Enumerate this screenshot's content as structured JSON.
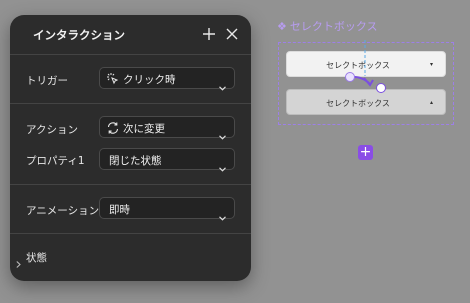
{
  "panel": {
    "title": "インタラクション",
    "trigger": {
      "label": "トリガー",
      "value": "クリック時",
      "icon": "click-icon"
    },
    "action": {
      "label": "アクション",
      "value": "次に変更",
      "icon": "swap-icon"
    },
    "property": {
      "label": "プロパティ1",
      "value": "閉じた状態"
    },
    "animation": {
      "label": "アニメーション",
      "value": "即時"
    },
    "state": {
      "label": "状態"
    }
  },
  "canvas": {
    "frame_label": "セレクトボックス",
    "frame_icon": "❖",
    "box1": {
      "text": "セレクトボックス",
      "arrow": "▾"
    },
    "box2": {
      "text": "セレクトボックス",
      "arrow": "▴"
    },
    "add_button": "+"
  },
  "colors": {
    "panel_bg": "#2c2c2c",
    "canvas_bg": "#929292",
    "accent": "#8a4de6"
  }
}
